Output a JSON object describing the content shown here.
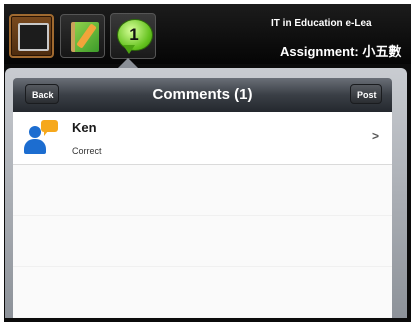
{
  "topbar": {
    "title_line1": "IT in Education e-Lea",
    "title_line2": "Assignment: 小五數",
    "icons": [
      "chalkboard-icon",
      "notebook-icon",
      "comments-icon"
    ],
    "comment_badge": "1"
  },
  "popover": {
    "title": "Comments (1)",
    "back_label": "Back",
    "post_label": "Post",
    "items": [
      {
        "name": "Ken",
        "text": "Correct"
      }
    ]
  },
  "colors": {
    "bar_dark": "#0b0b0b",
    "accent_green": "#64c21e",
    "user_blue": "#1c6dd0",
    "bubble_orange": "#f6a81c"
  }
}
